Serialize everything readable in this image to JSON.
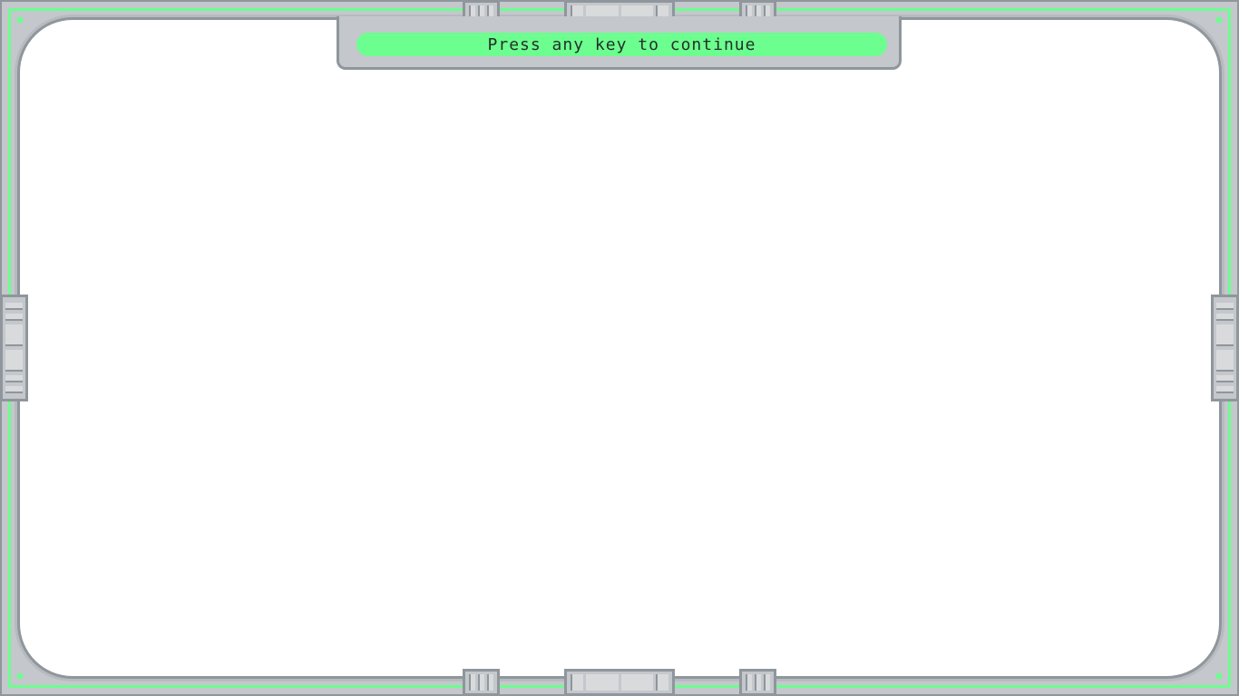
{
  "prompt": {
    "text": "Press any key to continue"
  },
  "colors": {
    "frame": "#c4c7cb",
    "frame_border": "#8f969c",
    "accent_green": "#6cff8f",
    "screen": "#ffffff",
    "text": "#25302a"
  }
}
